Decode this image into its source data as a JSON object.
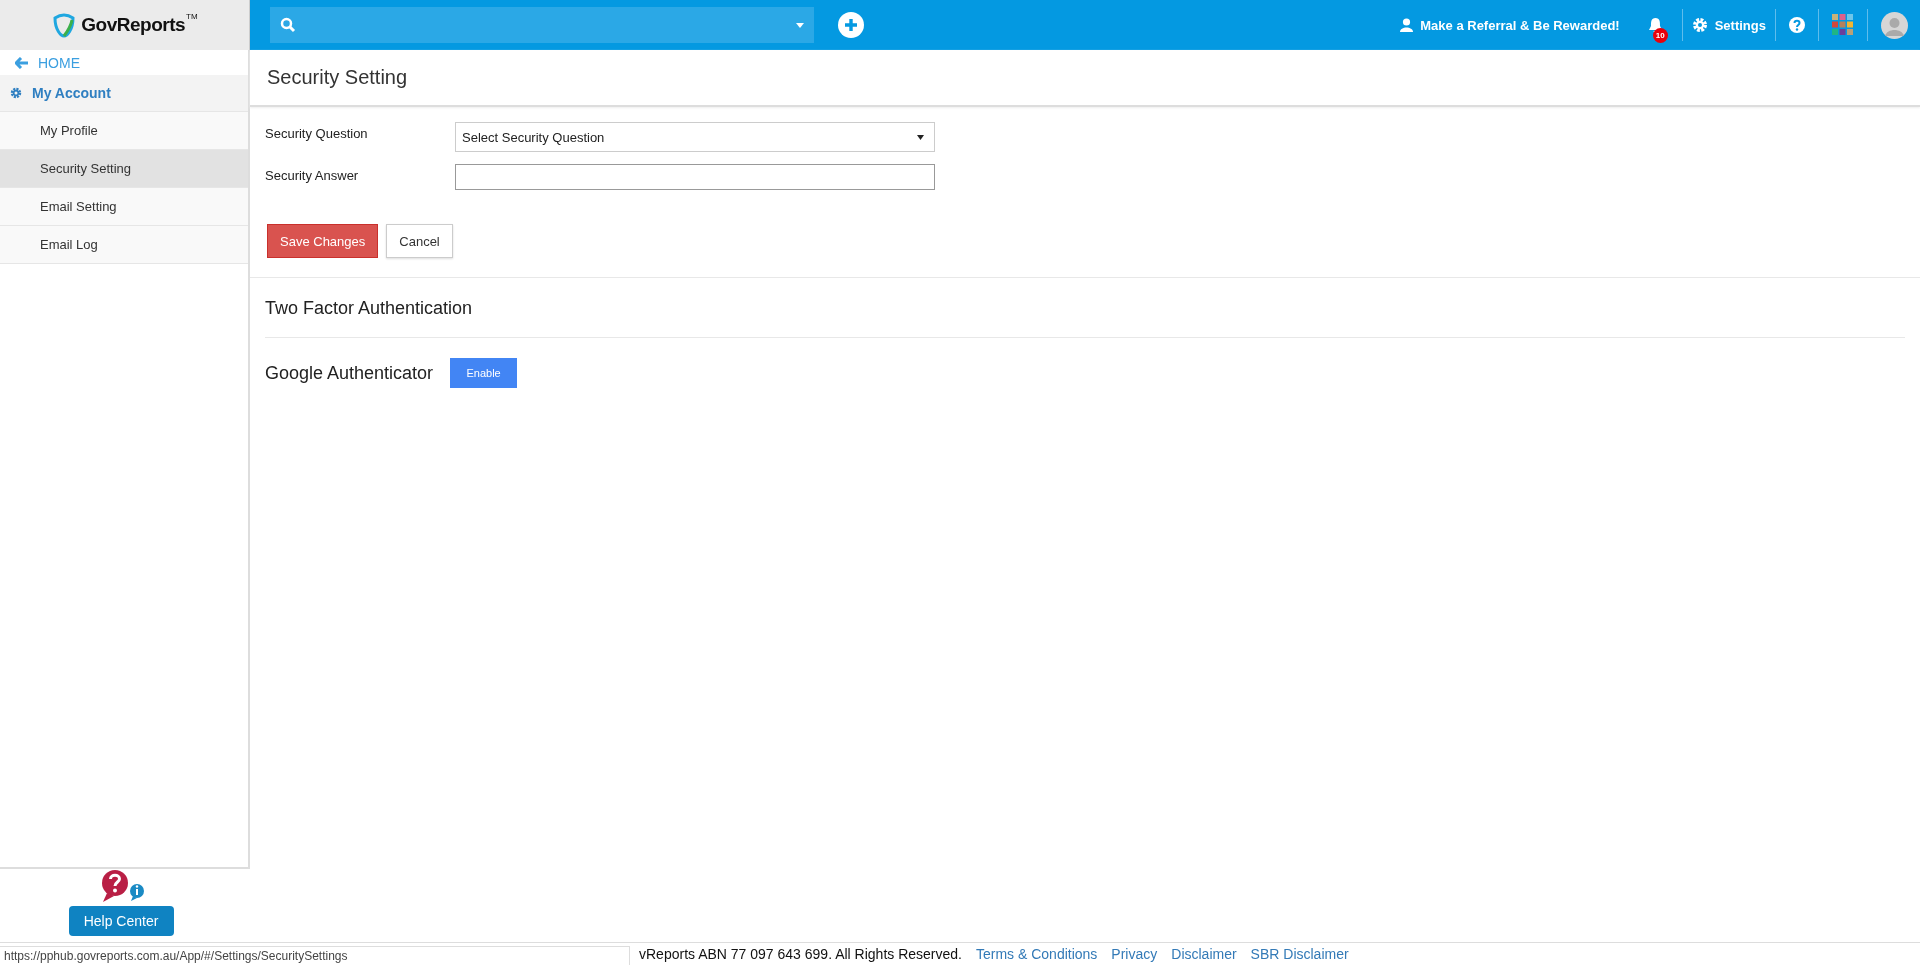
{
  "header": {
    "logo": "GovReports",
    "logo_mark": "TM",
    "referral": "Make a Referral & Be Rewarded!",
    "notification_count": "10",
    "settings": "Settings"
  },
  "sidebar": {
    "home": "HOME",
    "section": "My Account",
    "items": [
      {
        "label": "My Profile",
        "selected": false
      },
      {
        "label": "Security Setting",
        "selected": true
      },
      {
        "label": "Email Setting",
        "selected": false
      },
      {
        "label": "Email Log",
        "selected": false
      }
    ]
  },
  "page": {
    "title": "Security Setting",
    "fields": [
      {
        "kind": "select",
        "label": "Security Question",
        "value": "Select Security Question"
      },
      {
        "kind": "text",
        "label": "Security Answer"
      }
    ],
    "buttons": {
      "save": "Save Changes",
      "cancel": "Cancel"
    },
    "two_factor": {
      "heading": "Two Factor Authentication",
      "method": "Google Authenticator",
      "button": "Enable"
    }
  },
  "help": {
    "button": "Help Center"
  },
  "status_url": "https://pphub.govreports.com.au/App/#/Settings/SecuritySettings",
  "footer": {
    "copyright": "vReports ABN 77 097 643 699. All Rights Reserved.",
    "links": [
      "Terms & Conditions",
      "Privacy",
      "Disclaimer",
      "SBR Disclaimer"
    ]
  }
}
